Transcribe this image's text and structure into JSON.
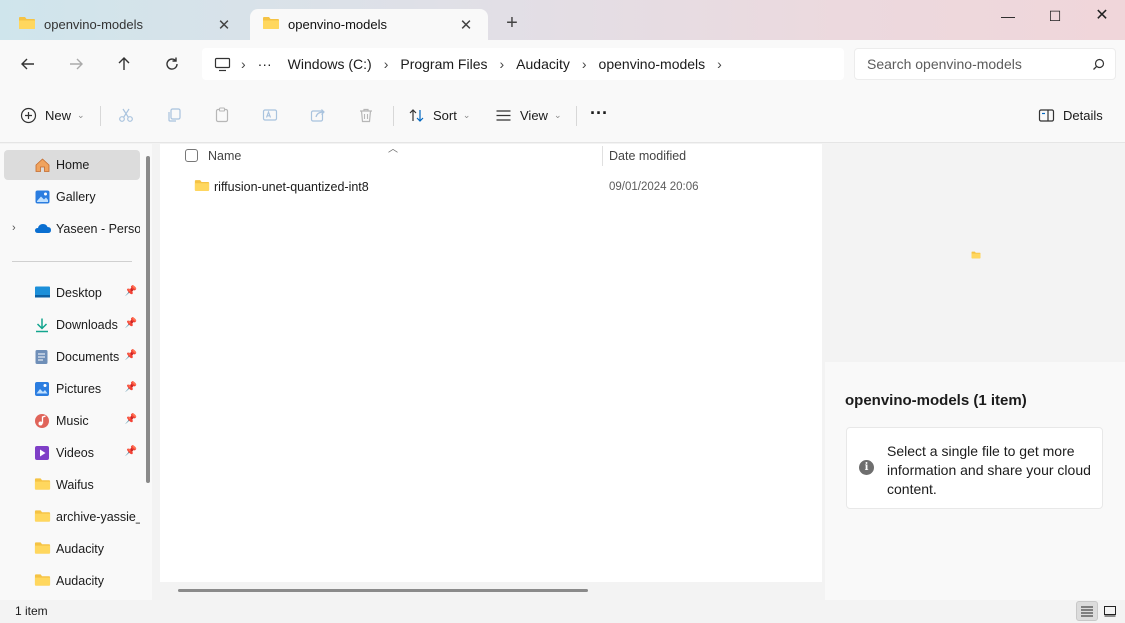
{
  "tabs": [
    {
      "label": "openvino-models",
      "active": false
    },
    {
      "label": "openvino-models",
      "active": true
    }
  ],
  "window_controls": {
    "minimize": "—",
    "maximize": "☐",
    "close": "✕"
  },
  "address": {
    "overflow": "···",
    "crumbs": [
      "Windows (C:)",
      "Program Files",
      "Audacity",
      "openvino-models"
    ]
  },
  "search": {
    "placeholder": "Search openvino-models",
    "value": ""
  },
  "toolbar": {
    "new_label": "New",
    "sort_label": "Sort",
    "view_label": "View",
    "more_label": "···",
    "details_label": "Details"
  },
  "sidebar": {
    "items": [
      {
        "label": "Home",
        "icon": "home-icon",
        "selected": true
      },
      {
        "label": "Gallery",
        "icon": "gallery-icon"
      },
      {
        "label": "Yaseen - Personal",
        "icon": "onedrive-icon"
      },
      {
        "label": "Desktop",
        "icon": "desktop-icon",
        "pinned": true
      },
      {
        "label": "Downloads",
        "icon": "downloads-icon",
        "pinned": true
      },
      {
        "label": "Documents",
        "icon": "documents-icon",
        "pinned": true
      },
      {
        "label": "Pictures",
        "icon": "pictures-icon",
        "pinned": true
      },
      {
        "label": "Music",
        "icon": "music-icon",
        "pinned": true
      },
      {
        "label": "Videos",
        "icon": "videos-icon",
        "pinned": true
      },
      {
        "label": "Waifus",
        "icon": "folder-icon"
      },
      {
        "label": "archive-yassie_j-",
        "icon": "folder-icon"
      },
      {
        "label": "Audacity",
        "icon": "folder-icon"
      },
      {
        "label": "Audacity",
        "icon": "folder-icon"
      }
    ]
  },
  "filelist": {
    "columns": {
      "name": "Name",
      "date": "Date modified"
    },
    "rows": [
      {
        "name": "riffusion-unet-quantized-int8",
        "date": "09/01/2024 20:06",
        "type": "folder"
      }
    ]
  },
  "details": {
    "title": "openvino-models (1 item)",
    "info": "Select a single file to get more information and share your cloud content."
  },
  "status": {
    "count": "1 item"
  },
  "colors": {
    "folder": "#f5c344",
    "accent": "#0067c0"
  }
}
